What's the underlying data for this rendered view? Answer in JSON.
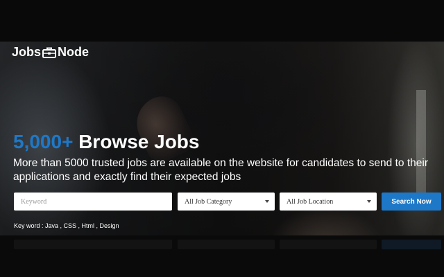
{
  "brand": {
    "name_left": "Jobs",
    "name_right": "Node",
    "icon": "briefcase-icon"
  },
  "hero": {
    "headline_accent": "5,000+",
    "headline_rest": " Browse Jobs",
    "subtext": "More than 5000 trusted jobs are available on the website for candidates to send to their applications and exactly find their expected jobs"
  },
  "search": {
    "keyword_placeholder": "Keyword",
    "category_selected": "All Job Category",
    "location_selected": "All Job Location",
    "button_label": "Search Now"
  },
  "keywords_line": "Key word : Java , CSS , Html , Design",
  "colors": {
    "accent": "#1e78c8",
    "text": "#ffffff"
  }
}
